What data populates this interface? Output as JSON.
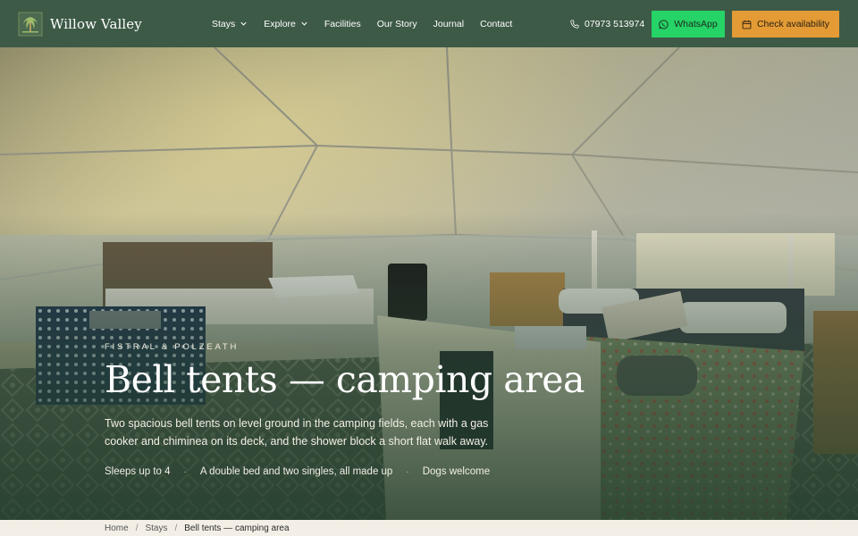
{
  "header": {
    "brand": "Willow Valley",
    "nav": [
      {
        "label": "Stays",
        "dropdown": true
      },
      {
        "label": "Explore",
        "dropdown": true
      },
      {
        "label": "Facilities",
        "dropdown": false
      },
      {
        "label": "Our Story",
        "dropdown": false
      },
      {
        "label": "Journal",
        "dropdown": false
      },
      {
        "label": "Contact",
        "dropdown": false
      }
    ],
    "phone": "07973 513974",
    "whatsapp_label": "WhatsApp",
    "book_label": "Check availability"
  },
  "hero": {
    "eyebrow": "Fistral & Polzeath",
    "title": "Bell tents — camping area",
    "description": "Two spacious bell tents on level ground in the camping fields, each with a gas cooker and chiminea on its deck, and the shower block a short flat walk away.",
    "facts": [
      "Sleeps up to 4",
      "A double bed and two singles, all made up",
      "Dogs welcome"
    ],
    "separator": "·"
  },
  "breadcrumb": {
    "items": [
      "Home",
      "Stays"
    ],
    "current": "Bell tents — camping area",
    "separator": "/"
  },
  "colors": {
    "header_bg": "#3d5a46",
    "whatsapp": "#25d366",
    "cta": "#e49b35",
    "page_bg": "#f4efe6"
  },
  "icons": {
    "phone": "phone-icon",
    "whatsapp": "whatsapp-icon",
    "book": "calendar-icon",
    "dropdown": "chevron-down-icon"
  }
}
